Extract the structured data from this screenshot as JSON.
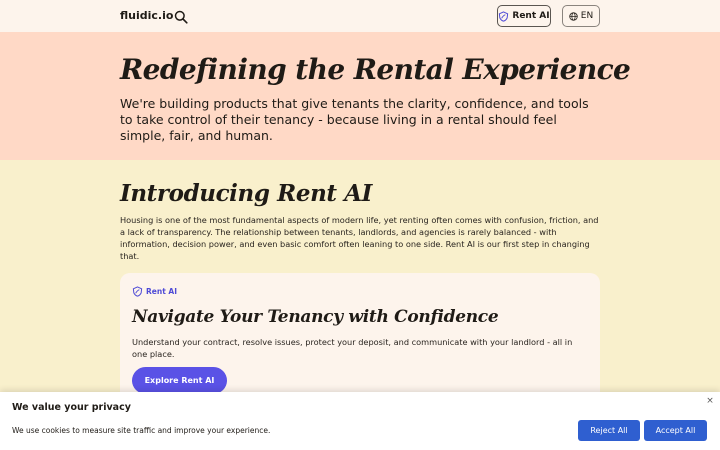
{
  "header": {
    "logo": "fluidic.io",
    "search_icon": "search-icon",
    "rentai_label": "Rent AI",
    "rentai_icon": "leaf-shield-icon",
    "lang_label": "EN",
    "lang_icon": "globe-icon"
  },
  "hero": {
    "title": "Redefining the Rental Experience",
    "subtitle": "We're building products that give tenants the clarity, confidence, and tools to take control of their tenancy - because living in a rental should feel simple, fair, and human."
  },
  "intro": {
    "title": "Introducing Rent AI",
    "body": "Housing is one of the most fundamental aspects of modern life, yet renting often comes with confusion, friction, and a lack of transparency. The relationship between tenants, landlords, and agencies is rarely balanced - with information, decision power, and even basic comfort often leaning to one side. Rent AI is our first step in changing that."
  },
  "card": {
    "tag": "Rent AI",
    "title": "Navigate Your Tenancy with Confidence",
    "body": "Understand your contract, resolve issues, protect your deposit, and communicate with your landlord - all in one place.",
    "cta": "Explore Rent AI"
  },
  "cookie": {
    "title": "We value your privacy",
    "text": "We use cookies to measure site traffic and improve your experience.",
    "reject": "Reject All",
    "accept": "Accept All",
    "close": "×"
  },
  "colors": {
    "header_bg": "#fdf4ec",
    "hero_bg": "#ffd9c6",
    "page_bg": "#f9f0cc",
    "card_bg": "#fdf4ec",
    "accent": "#5a52e6",
    "cookie_button": "#2f5fd0"
  }
}
